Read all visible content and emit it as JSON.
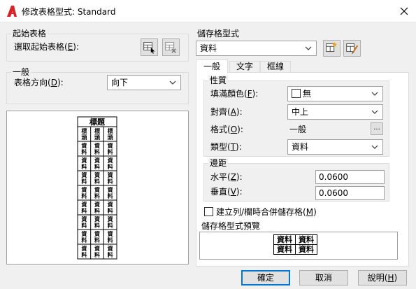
{
  "window": {
    "title": "修改表格型式: Standard"
  },
  "start_table": {
    "group_title": "起始表格",
    "select_label": "選取起始表格(",
    "select_key": "E",
    "select_suffix": "):"
  },
  "general": {
    "group_title": "一般",
    "direction_label": "表格方向(",
    "direction_key": "D",
    "direction_suffix": "):",
    "direction_value": "向下"
  },
  "preview_table": {
    "title": "標題",
    "header": "標頭",
    "data": "資料",
    "data_rows": 8
  },
  "cell_styles": {
    "group_title": "儲存格型式",
    "selected_style": "資料"
  },
  "tabs": [
    {
      "label": "一般"
    },
    {
      "label": "文字"
    },
    {
      "label": "框線"
    }
  ],
  "properties": {
    "group_title": "性質",
    "fill_label": "填滿顏色(",
    "fill_key": "F",
    "fill_suffix": "):",
    "fill_value": "無",
    "align_label": "對齊(",
    "align_key": "A",
    "align_suffix": "):",
    "align_value": "中上",
    "format_label": "格式(",
    "format_key": "O",
    "format_suffix": "):",
    "format_value": "一般",
    "format_button": "...",
    "type_label": "類型(",
    "type_key": "T",
    "type_suffix": "):",
    "type_value": "資料"
  },
  "margins": {
    "group_title": "邊距",
    "horizontal_label": "水平(",
    "horizontal_key": "Z",
    "horizontal_suffix": "):",
    "horizontal_value": "0.0600",
    "vertical_label": "垂直(",
    "vertical_key": "V",
    "vertical_suffix": "):",
    "vertical_value": "0.0600"
  },
  "merge_option": {
    "label": "建立列/欄時合併儲存格(",
    "key": "M",
    "suffix": ")",
    "checked": false
  },
  "cell_preview": {
    "group_title": "儲存格型式預覽",
    "cells": [
      [
        "資料",
        "資料"
      ],
      [
        "資料",
        "資料"
      ]
    ]
  },
  "buttons": {
    "ok": "確定",
    "cancel": "取消",
    "help_label": "說明(",
    "help_key": "H",
    "help_suffix": ")"
  },
  "colors": {
    "accent": "#0078d7",
    "app_icon": "#d6242a"
  }
}
